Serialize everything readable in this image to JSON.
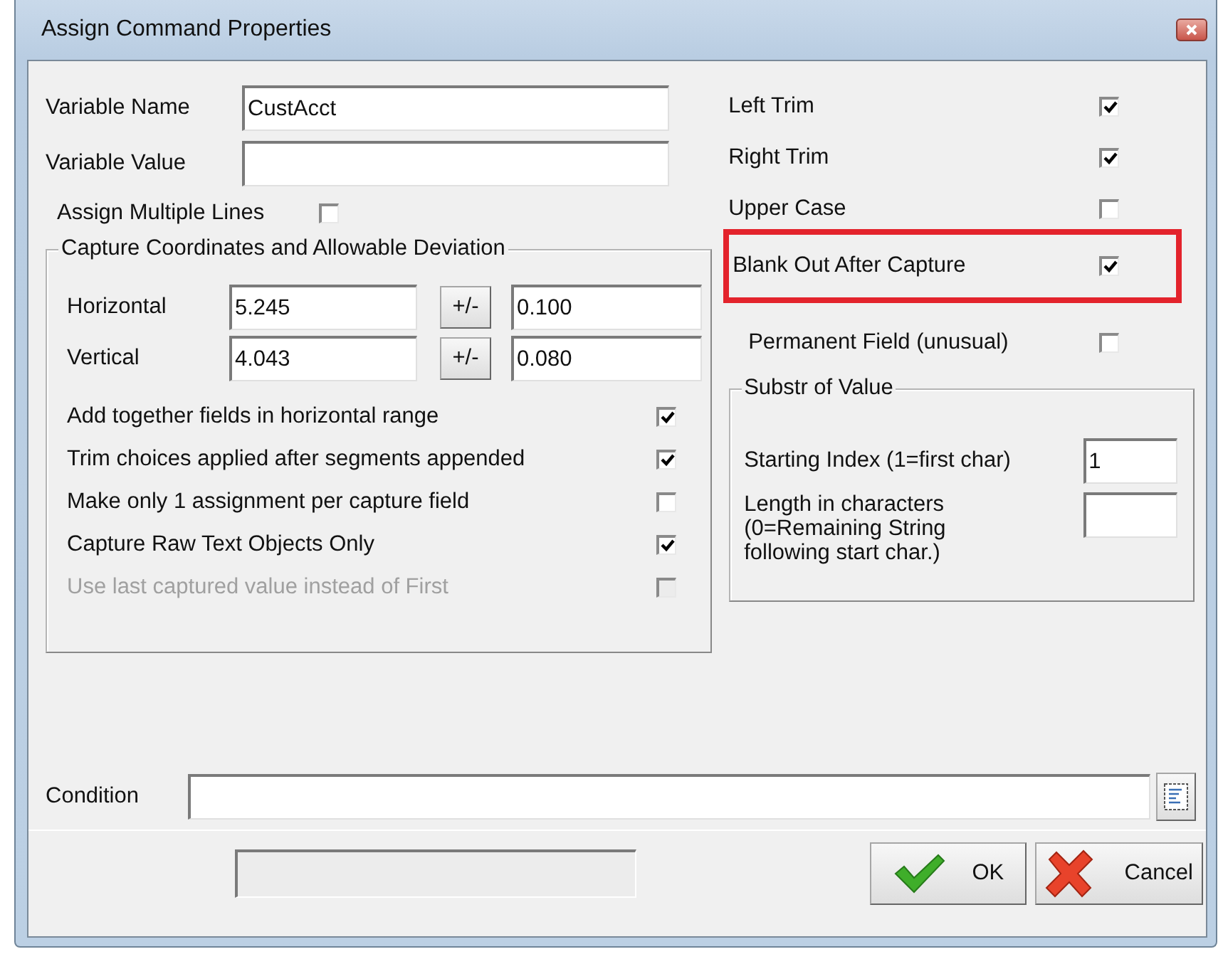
{
  "window": {
    "title": "Assign Command Properties"
  },
  "variable_name": {
    "label": "Variable Name",
    "value": "CustAcct"
  },
  "variable_value": {
    "label": "Variable Value"
  },
  "assign_multiple_lines": {
    "label": "Assign Multiple Lines",
    "checked": false
  },
  "capture_group": {
    "title": "Capture Coordinates and Allowable Deviation",
    "rows": [
      {
        "label": "Horizontal",
        "value": "5.245",
        "button": "+/-",
        "deviation": "0.100"
      },
      {
        "label": "Vertical",
        "value": "4.043",
        "button": "+/-",
        "deviation": "0.080"
      }
    ],
    "options": [
      {
        "label": "Add together fields in horizontal range",
        "checked": true,
        "disabled": false
      },
      {
        "label": "Trim choices applied after segments appended",
        "checked": true,
        "disabled": false
      },
      {
        "label": "Make only 1 assignment per capture field",
        "checked": false,
        "disabled": false
      },
      {
        "label": "Capture Raw Text Objects Only",
        "checked": true,
        "disabled": false
      },
      {
        "label": "Use last captured value instead of First",
        "checked": false,
        "disabled": true
      }
    ]
  },
  "trim_options": [
    {
      "label": "Left Trim",
      "checked": true,
      "highlighted": false
    },
    {
      "label": "Right Trim",
      "checked": true,
      "highlighted": false
    },
    {
      "label": "Upper Case",
      "checked": false,
      "highlighted": false
    },
    {
      "label": "Blank Out After Capture",
      "checked": true,
      "highlighted": true
    }
  ],
  "permanent_field": {
    "label": "Permanent Field (unusual)",
    "checked": false
  },
  "substr_group": {
    "title": "Substr of Value",
    "starting_index": {
      "label": "Starting Index (1=first char)",
      "value": "1"
    },
    "length": {
      "label": "Length in characters\n(0=Remaining String\nfollowing start char.)"
    }
  },
  "condition": {
    "label": "Condition"
  },
  "buttons": [
    {
      "kind": "ok",
      "label": "OK"
    },
    {
      "kind": "cancel",
      "label": "Cancel"
    }
  ]
}
